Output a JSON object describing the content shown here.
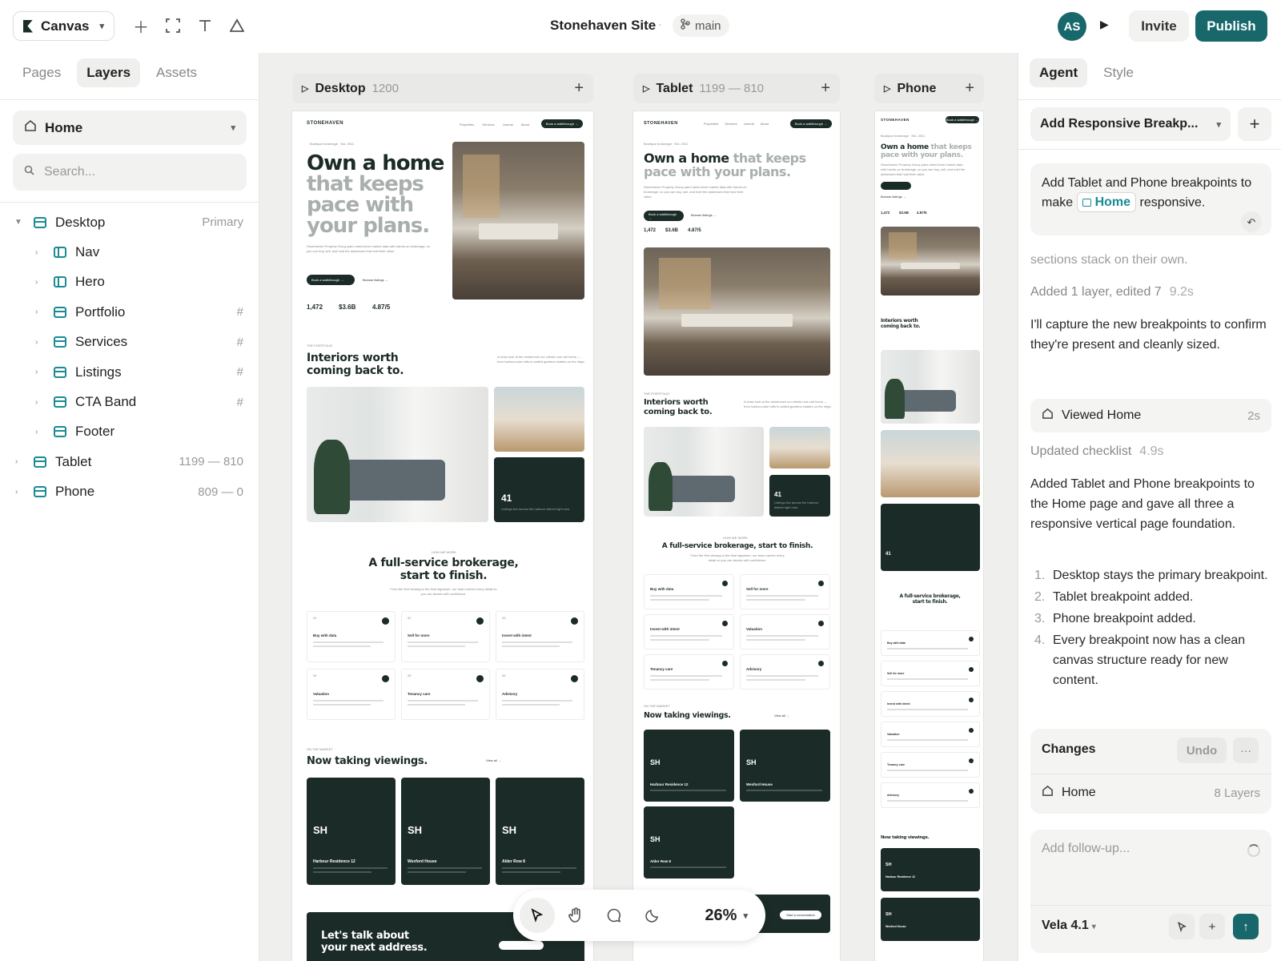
{
  "topbar": {
    "brand": "Canvas",
    "title": "Stonehaven Site",
    "branch": "main",
    "avatar_initials": "AS",
    "invite_label": "Invite",
    "publish_label": "Publish"
  },
  "left": {
    "tabs": [
      "Pages",
      "Layers",
      "Assets"
    ],
    "page": "Home",
    "search_placeholder": "Search...",
    "tree": [
      {
        "label": "Desktop",
        "meta": "Primary"
      },
      {
        "label": "Nav",
        "meta": ""
      },
      {
        "label": "Hero",
        "meta": ""
      },
      {
        "label": "Portfolio",
        "meta": "#"
      },
      {
        "label": "Services",
        "meta": "#"
      },
      {
        "label": "Listings",
        "meta": "#"
      },
      {
        "label": "CTA Band",
        "meta": "#"
      },
      {
        "label": "Footer",
        "meta": ""
      },
      {
        "label": "Tablet",
        "meta": "1199 — 810"
      },
      {
        "label": "Phone",
        "meta": "809 — 0"
      }
    ]
  },
  "canvas": {
    "frames": [
      {
        "name": "Desktop",
        "size": "1200"
      },
      {
        "name": "Tablet",
        "size": "1199 — 810"
      },
      {
        "name": "Phone",
        "size": ""
      }
    ],
    "site": {
      "brand": "STONEHAVEN",
      "nav_links": [
        "Properties",
        "Services",
        "Journal",
        "About"
      ],
      "nav_cta": "Book a walkthrough →",
      "eyebrow": "Boutique brokerage · Est. 2011",
      "hero_dark": "Own a home",
      "hero_light": "that keeps pace with your plans.",
      "hero_line1_dark": "Own a home",
      "hero_line2": "that keeps",
      "hero_line3": "pace with",
      "hero_line4": "your plans.",
      "hero_body": "Stonehaven Property Group pairs street-level market data with hands-on brokerage, so you can buy, sell, and hold the addresses that hold their value.",
      "cta_primary": "Book a walkthrough →",
      "cta_secondary": "Browse listings →",
      "stats": [
        "1,472",
        "$3.6B",
        "4.87/5"
      ],
      "portfolio_eyebrow": "THE PORTFOLIO",
      "portfolio_title_1": "Interiors worth",
      "portfolio_title_2": "coming back to.",
      "portfolio_note": "A close look at the residences our clients now call home — from harbour-side lofts to walled gardens estates on the ridge.",
      "count_big": "41",
      "count_caption": "Listings live across the harbour district right now.",
      "services_eyebrow": "HOW WE WORK",
      "services_title_1": "A full-service brokerage,",
      "services_title_2": "start to finish.",
      "services_title_tablet": "A full-service brokerage, start to finish.",
      "services_body": "From the first viewing to the final signature, our team carries every detail so you can decide with confidence.",
      "services": [
        {
          "num": "01",
          "name": "Buy with data"
        },
        {
          "num": "02",
          "name": "Sell for more"
        },
        {
          "num": "03",
          "name": "Invest with intent"
        },
        {
          "num": "04",
          "name": "Valuation"
        },
        {
          "num": "05",
          "name": "Tenancy care"
        },
        {
          "num": "06",
          "name": "Advisory"
        }
      ],
      "market_eyebrow": "ON THE MARKET",
      "market_title": "Now taking viewings.",
      "view_all": "View all →",
      "listings": [
        {
          "initials": "SH",
          "name": "Harbour Residence 12"
        },
        {
          "initials": "SH",
          "name": "Wexford House"
        },
        {
          "initials": "SH",
          "name": "Alder Row 8"
        }
      ],
      "cta_band_1": "Let's talk about",
      "cta_band_2": "your next address.",
      "cta_band_btn": "Start a conversation"
    }
  },
  "toolbar": {
    "zoom": "26%"
  },
  "right": {
    "tabs": [
      "Agent",
      "Style"
    ],
    "conversation": "Add Responsive Breakp...",
    "user_msg_1": "Add Tablet and Phone breakpoints to make",
    "user_chip": "Home",
    "user_msg_2": "responsive.",
    "faded_text": "sections stack on their own.",
    "meta_1": "Added 1 layer, edited 7",
    "meta_1_time": "9.2s",
    "para_1": "I'll capture the new breakpoints to confirm they're present and cleanly sized.",
    "viewed": "Viewed Home",
    "viewed_time": "2s",
    "meta_2": "Updated checklist",
    "meta_2_time": "4.9s",
    "para_2": "Added Tablet and Phone breakpoints to the Home page and gave all three a responsive vertical page foundation.",
    "checklist": [
      "Desktop stays the primary breakpoint.",
      "Tablet breakpoint added.",
      "Phone breakpoint added.",
      "Every breakpoint now has a clean canvas structure ready for new content."
    ],
    "changes_label": "Changes",
    "undo_label": "Undo",
    "change_row": "Home",
    "change_count": "8 Layers",
    "composer_placeholder": "Add follow-up...",
    "model": "Vela 4.1"
  }
}
